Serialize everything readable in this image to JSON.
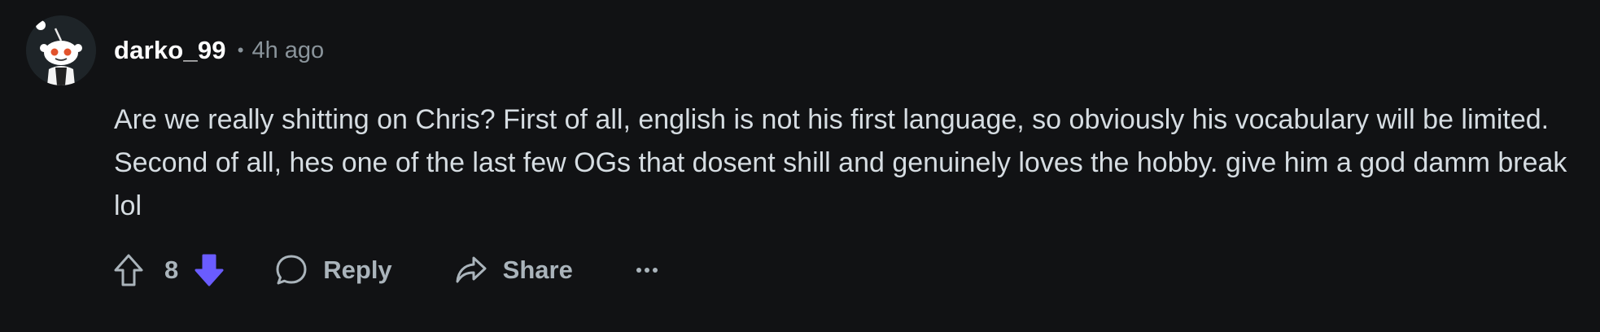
{
  "comment": {
    "username": "darko_99",
    "separator": "•",
    "time": "4h ago",
    "body": "Are we really shitting on Chris? First of all, english is not his first language, so obviously his vocabulary will be limited. Second of all, hes one of the last few OGs that dosent shill and genuinely loves the hobby. give him a god damm break lol",
    "vote_count": "8",
    "reply_label": "Reply",
    "share_label": "Share"
  },
  "colors": {
    "background": "#111214",
    "downvote_active": "#6a5cff",
    "text_muted": "#aab4bb"
  },
  "icons": {
    "avatar": "snoo-avatar",
    "upvote": "arrow-up-outline-icon",
    "downvote": "arrow-down-filled-icon",
    "reply": "speech-bubble-icon",
    "share": "share-arrow-icon",
    "more": "ellipsis-icon"
  }
}
